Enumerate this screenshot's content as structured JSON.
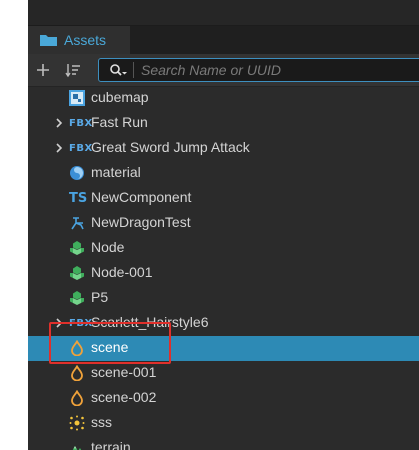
{
  "tab": {
    "label": "Assets",
    "icon": "folder-icon"
  },
  "toolbar": {
    "add_icon": "plus-icon",
    "sort_icon": "sort-icon",
    "search_icon": "search-filter-icon",
    "search_placeholder": "Search Name or UUID",
    "search_value": ""
  },
  "tree": {
    "items": [
      {
        "label": "cubemap",
        "icon": "cubemap-icon",
        "expandable": false,
        "selected": false
      },
      {
        "label": "Fast Run",
        "icon": "FBX",
        "expandable": true,
        "selected": false
      },
      {
        "label": "Great Sword Jump Attack",
        "icon": "FBX",
        "expandable": true,
        "selected": false
      },
      {
        "label": "material",
        "icon": "material-icon",
        "expandable": false,
        "selected": false
      },
      {
        "label": "NewComponent",
        "icon": "TS",
        "expandable": false,
        "selected": false
      },
      {
        "label": "NewDragonTest",
        "icon": "dragonbones-icon",
        "expandable": false,
        "selected": false
      },
      {
        "label": "Node",
        "icon": "prefab-icon",
        "expandable": false,
        "selected": false
      },
      {
        "label": "Node-001",
        "icon": "prefab-icon",
        "expandable": false,
        "selected": false
      },
      {
        "label": "P5",
        "icon": "prefab-icon",
        "expandable": false,
        "selected": false
      },
      {
        "label": "Scarlett_Hairstyle6",
        "icon": "FBX",
        "expandable": true,
        "selected": false
      },
      {
        "label": "scene",
        "icon": "scene-icon",
        "expandable": false,
        "selected": true
      },
      {
        "label": "scene-001",
        "icon": "scene-icon",
        "expandable": false,
        "selected": false
      },
      {
        "label": "scene-002",
        "icon": "scene-icon",
        "expandable": false,
        "selected": false
      },
      {
        "label": "sss",
        "icon": "particle-icon",
        "expandable": false,
        "selected": false
      },
      {
        "label": "terrain",
        "icon": "terrain-icon",
        "expandable": false,
        "selected": false
      }
    ]
  },
  "colors": {
    "selection": "#2d8ab5",
    "accent": "#4aa8d8",
    "highlight_box": "#e0302b"
  }
}
